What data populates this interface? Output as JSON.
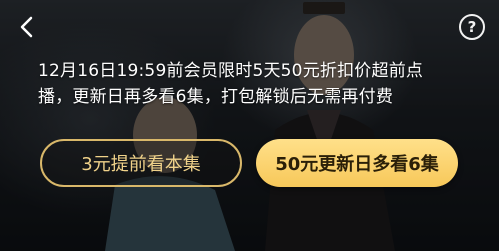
{
  "header": {
    "back_icon": "chevron-left-icon",
    "help_icon": "question-mark-icon",
    "help_glyph": "?"
  },
  "paywall": {
    "message_line1": "12月16日19:59前会员限时5天50元折扣价超前点",
    "message_line2": "播，更新日再多看6集，打包解锁后无需再付费",
    "buy_single_label": "3元提前看本集",
    "buy_package_label": "50元更新日多看6集"
  },
  "colors": {
    "accent_gold": "#f7c85a",
    "outline_gold": "#d9b86a",
    "text_white": "#ffffff"
  }
}
